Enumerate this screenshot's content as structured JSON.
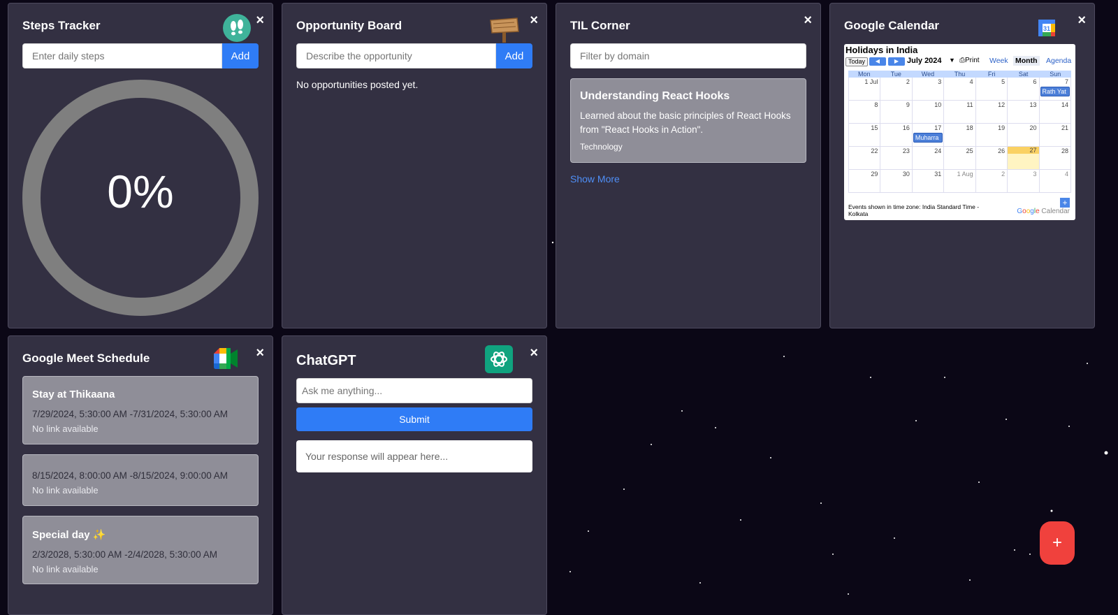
{
  "steps": {
    "title": "Steps Tracker",
    "icon": "footprints-icon",
    "input_placeholder": "Enter daily steps",
    "add_label": "Add",
    "progress_text": "0%",
    "progress_fraction": 0.0,
    "close_label": "×"
  },
  "opportunity": {
    "title": "Opportunity Board",
    "icon": "wooden-signpost-icon",
    "input_placeholder": "Describe the opportunity",
    "add_label": "Add",
    "empty_message": "No opportunities posted yet.",
    "close_label": "×"
  },
  "til": {
    "title": "TIL Corner",
    "filter_placeholder": "Filter by domain",
    "card": {
      "title": "Understanding React Hooks",
      "description": "Learned about the basic principles of React Hooks from \"React Hooks in Action\".",
      "category": "Technology"
    },
    "show_more": "Show More",
    "close_label": "×"
  },
  "calendar": {
    "title": "Google Calendar",
    "icon": "google-calendar-icon",
    "close_label": "×",
    "embed": {
      "calendar_name": "Holidays in India",
      "today_label": "Today",
      "month_label": "July 2024",
      "print_label": "Print",
      "tabs": [
        "Week",
        "Month",
        "Agenda"
      ],
      "active_tab": "Month",
      "days_of_week": [
        "Mon",
        "Tue",
        "Wed",
        "Thu",
        "Fri",
        "Sat",
        "Sun"
      ],
      "weeks": [
        [
          "1 Jul",
          "2",
          "3",
          "4",
          "5",
          "6",
          "7"
        ],
        [
          "8",
          "9",
          "10",
          "11",
          "12",
          "13",
          "14"
        ],
        [
          "15",
          "16",
          "17",
          "18",
          "19",
          "20",
          "21"
        ],
        [
          "22",
          "23",
          "24",
          "25",
          "26",
          "27",
          "28"
        ],
        [
          "29",
          "30",
          "31",
          "1 Aug",
          "2",
          "3",
          "4"
        ]
      ],
      "today": "27",
      "events": [
        {
          "label": "Rath Yat",
          "week": 0,
          "day": 6
        },
        {
          "label": "Muharra",
          "week": 2,
          "day": 2
        }
      ],
      "footer": "Events shown in time zone: India Standard Time - Kolkata",
      "brand": "Google Calendar",
      "brand_colors": [
        "#4285f4",
        "#ea4335",
        "#fbbc05",
        "#4285f4",
        "#34a853",
        "#ea4335"
      ]
    }
  },
  "meet": {
    "title": "Google Meet Schedule",
    "icon": "google-meet-icon",
    "close_label": "×",
    "events": [
      {
        "title": "Stay at Thikaana",
        "datetime": "7/29/2024, 5:30:00 AM -7/31/2024, 5:30:00 AM",
        "link": "No link available"
      },
      {
        "title": "",
        "datetime": "8/15/2024, 8:00:00 AM -8/15/2024, 9:00:00 AM",
        "link": "No link available"
      },
      {
        "title": "Special day ✨",
        "datetime": "2/3/2028, 5:30:00 AM -2/4/2028, 5:30:00 AM",
        "link": "No link available"
      }
    ]
  },
  "chatgpt": {
    "title": "ChatGPT",
    "icon": "openai-logo-icon",
    "input_placeholder": "Ask me anything...",
    "submit_label": "Submit",
    "response_placeholder": "Your response will appear here...",
    "close_label": "×"
  },
  "fab": {
    "label": "+",
    "icon": "plus-icon",
    "color": "#f0413d"
  },
  "colors": {
    "background": "#0b0716",
    "widget": "#333042",
    "accent_blue": "#2f7cf6",
    "card_gray": "#8f8e98",
    "link_blue": "#4f8ff7"
  }
}
